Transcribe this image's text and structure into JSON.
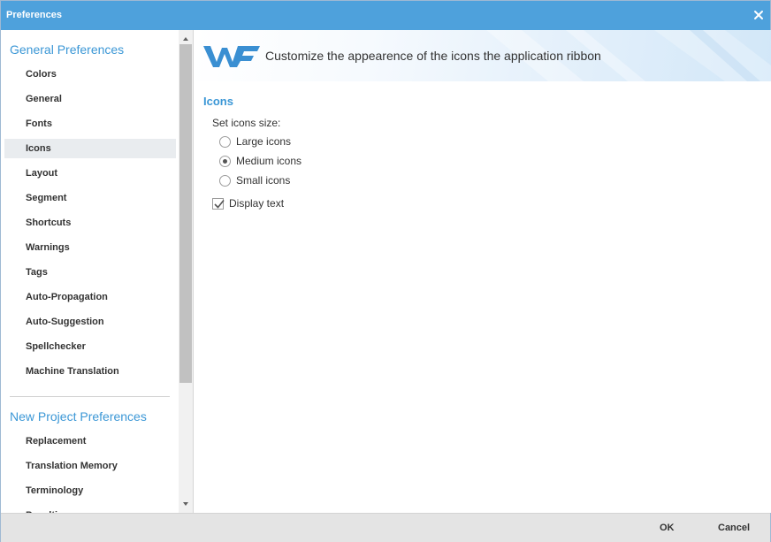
{
  "window": {
    "title": "Preferences",
    "close_icon": "close-icon"
  },
  "sidebar": {
    "general_title": "General Preferences",
    "general_items": [
      {
        "label": "Colors"
      },
      {
        "label": "General"
      },
      {
        "label": "Fonts"
      },
      {
        "label": "Icons",
        "active": true
      },
      {
        "label": "Layout"
      },
      {
        "label": "Segment"
      },
      {
        "label": "Shortcuts"
      },
      {
        "label": "Warnings"
      },
      {
        "label": "Tags"
      },
      {
        "label": "Auto-Propagation"
      },
      {
        "label": "Auto-Suggestion"
      },
      {
        "label": "Spellchecker"
      },
      {
        "label": "Machine Translation"
      }
    ],
    "project_title": "New Project Preferences",
    "project_items": [
      {
        "label": "Replacement"
      },
      {
        "label": "Translation Memory"
      },
      {
        "label": "Terminology"
      },
      {
        "label": "Penalties"
      }
    ]
  },
  "banner": {
    "logo": "wf-logo",
    "text": "Customize the appearence of the icons the application ribbon"
  },
  "content": {
    "section_title": "Icons",
    "set_size_label": "Set icons size:",
    "options": [
      {
        "label": "Large icons",
        "checked": false
      },
      {
        "label": "Medium icons",
        "checked": true
      },
      {
        "label": "Small icons",
        "checked": false
      }
    ],
    "display_text": {
      "label": "Display text",
      "checked": true
    }
  },
  "footer": {
    "ok_label": "OK",
    "cancel_label": "Cancel"
  },
  "colors": {
    "accent": "#3b97d6",
    "titlebar": "#4ea1dc",
    "footer": "#e4e4e4",
    "active_item": "#e9ecef"
  }
}
